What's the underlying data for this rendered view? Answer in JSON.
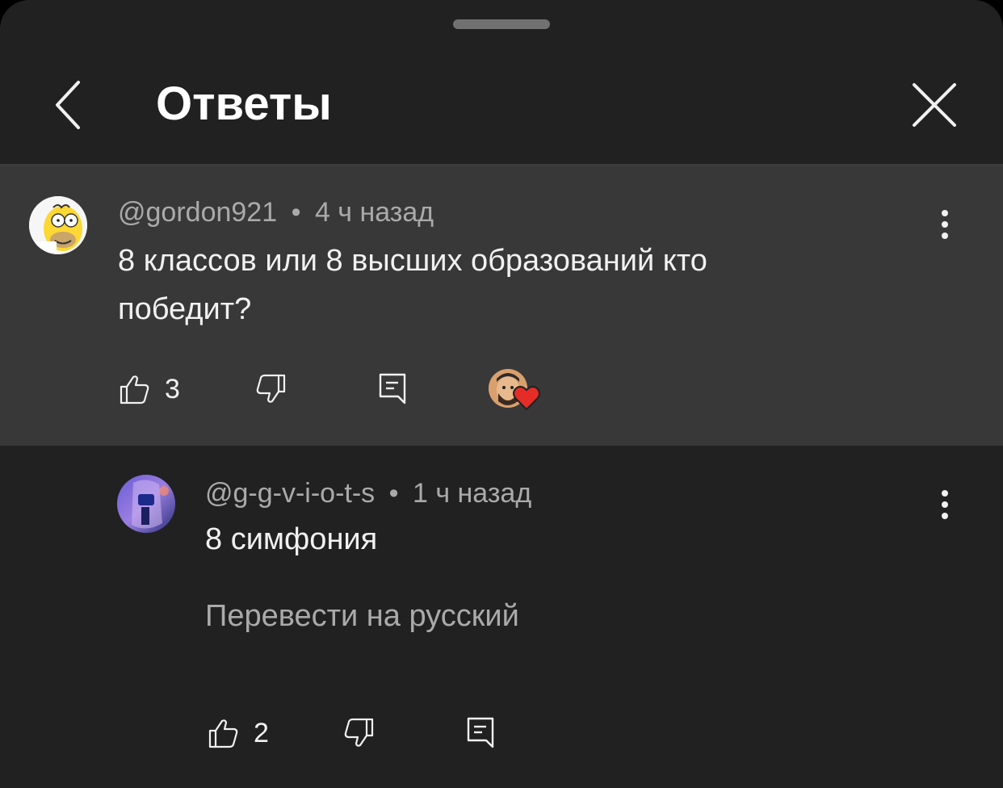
{
  "header": {
    "title": "Ответы"
  },
  "parent_comment": {
    "author": "@gordon921",
    "separator": "•",
    "time": "4 ч назад",
    "text": "8 классов или 8 высших образований кто победит?",
    "likes": "3",
    "creator_heart": true
  },
  "reply": {
    "author": "@g-g-v-i-o-t-s",
    "separator": "•",
    "time": "1 ч назад",
    "text": "8 симфония",
    "translate_label": "Перевести на русский",
    "likes": "2"
  },
  "colors": {
    "background": "#212121",
    "highlight": "#383838",
    "text_primary": "#f1f1f1",
    "text_secondary": "#aaaaaa",
    "heart": "#e52d27"
  },
  "icons": {
    "back": "chevron-left-icon",
    "close": "close-icon",
    "like": "thumbs-up-icon",
    "dislike": "thumbs-down-icon",
    "reply": "comment-icon",
    "more": "more-vertical-icon",
    "heart": "heart-icon"
  }
}
